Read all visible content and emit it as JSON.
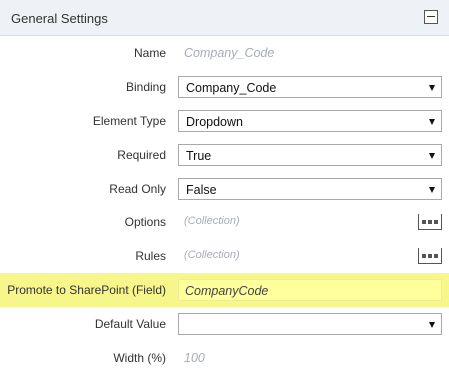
{
  "panel": {
    "title": "General Settings"
  },
  "fields": {
    "name": {
      "label": "Name",
      "value": "Company_Code"
    },
    "binding": {
      "label": "Binding",
      "value": "Company_Code"
    },
    "element_type": {
      "label": "Element Type",
      "value": "Dropdown"
    },
    "required": {
      "label": "Required",
      "value": "True"
    },
    "read_only": {
      "label": "Read Only",
      "value": "False"
    },
    "options": {
      "label": "Options",
      "value": "(Collection)"
    },
    "rules": {
      "label": "Rules",
      "value": "(Collection)"
    },
    "promote": {
      "label": "Promote to SharePoint (Field)",
      "value": "CompanyCode"
    },
    "default_value": {
      "label": "Default Value",
      "value": ""
    },
    "width": {
      "label": "Width (%)",
      "value": "100"
    }
  },
  "colors": {
    "highlight_row": "#f6f68a",
    "highlight_input": "#ffff9c",
    "header_bg": "#eef1f5"
  }
}
